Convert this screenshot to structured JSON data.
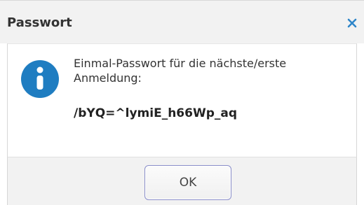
{
  "dialog": {
    "title": "Passwort",
    "close_icon": "close-icon",
    "info_icon": "info-icon",
    "message": "Einmal-Passwort für die nächste/erste Anmeldung:",
    "password": "/bYQ=^lymiE_h66Wp_aq",
    "ok_label": "OK"
  },
  "colors": {
    "title_bar": "#f2f2f2",
    "close_icon": "#2f86c9",
    "info_icon": "#1f7dc1",
    "button_border": "#8a8ec9"
  }
}
